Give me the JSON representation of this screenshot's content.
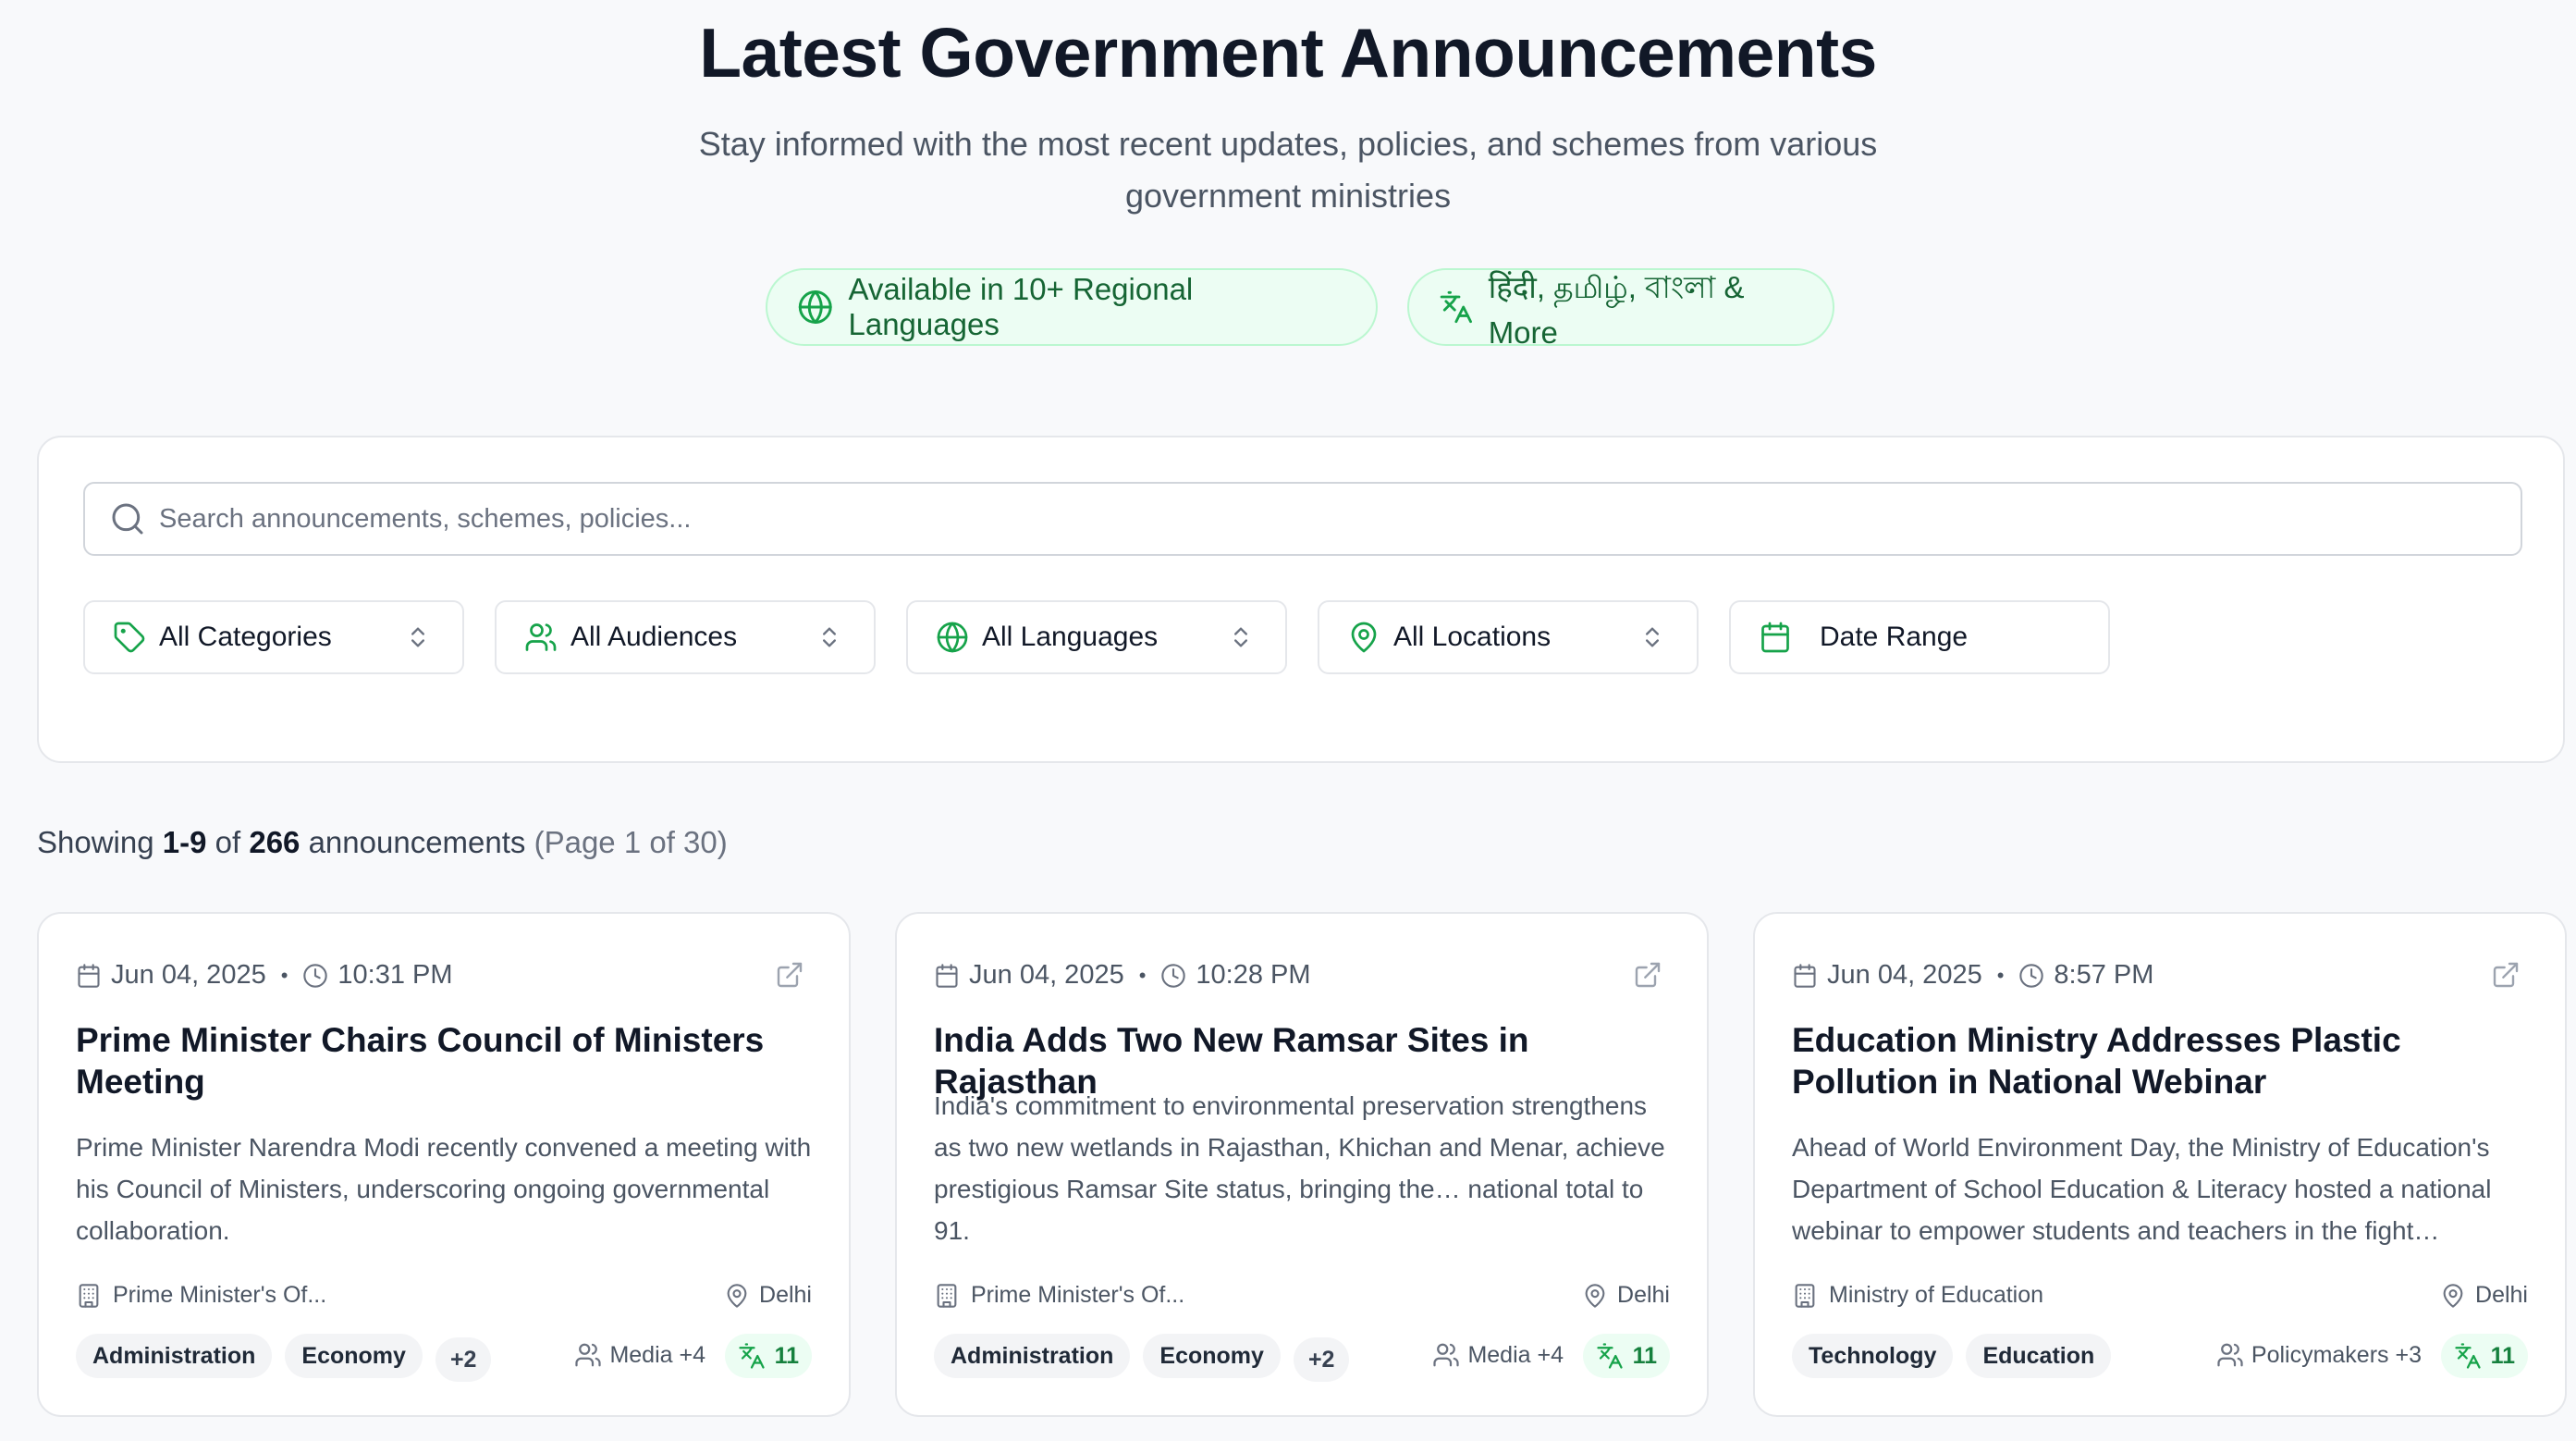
{
  "header": {
    "title": "Latest Government Announcements",
    "subtitle": "Stay informed with the most recent updates, policies, and schemes from various government ministries",
    "badges": [
      {
        "label": "Available in 10+ Regional Languages",
        "icon": "globe-icon"
      },
      {
        "label": "हिंदी, தமிழ், বাংলা & More",
        "icon": "translate-icon"
      }
    ]
  },
  "filters": {
    "search_placeholder": "Search announcements, schemes, policies...",
    "search_value": "",
    "selects": [
      {
        "label": "All Categories",
        "icon": "tag-icon"
      },
      {
        "label": "All Audiences",
        "icon": "users-icon"
      },
      {
        "label": "All Languages",
        "icon": "globe-icon"
      },
      {
        "label": "All Locations",
        "icon": "map-pin-icon"
      },
      {
        "label": "Date Range",
        "icon": "calendar-icon"
      }
    ]
  },
  "results": {
    "prefix": "Showing",
    "range": "1-9",
    "of": "of",
    "total": "266",
    "noun": "announcements",
    "page_info": "(Page 1 of 30)"
  },
  "cards": [
    {
      "date": "Jun 04, 2025",
      "time": "10:31 PM",
      "title": "Prime Minister Chairs Council of Ministers Meeting",
      "description": "Prime Minister Narendra Modi recently convened a meeting with his Council of Ministers, underscoring ongoing governmental collaboration.",
      "ministry": "Prime Minister's Of...",
      "location": "Delhi",
      "tags": [
        "Administration",
        "Economy"
      ],
      "more_tags": "+2",
      "audience": "Media +4",
      "languages": "11"
    },
    {
      "date": "Jun 04, 2025",
      "time": "10:28 PM",
      "title": "India Adds Two New Ramsar Sites in Rajasthan",
      "description": "India's commitment to environmental preservation strengthens as two new wetlands in Rajasthan, Khichan and Menar, achieve prestigious Ramsar Site status, bringing the… national total to 91.",
      "ministry": "Prime Minister's Of...",
      "location": "Delhi",
      "tags": [
        "Administration",
        "Economy"
      ],
      "more_tags": "+2",
      "audience": "Media +4",
      "languages": "11"
    },
    {
      "date": "Jun 04, 2025",
      "time": "8:57 PM",
      "title": "Education Ministry Addresses Plastic Pollution in National Webinar",
      "description": "Ahead of World Environment Day, the Ministry of Education's Department of School Education & Literacy hosted a national webinar to empower students and teachers in the fight…",
      "ministry": "Ministry of Education",
      "location": "Delhi",
      "tags": [
        "Technology",
        "Education"
      ],
      "more_tags": "",
      "audience": "Policymakers +3",
      "languages": "11"
    }
  ],
  "colors": {
    "accent": "#16a34a",
    "accent_bg": "#ecfdf3",
    "text_primary": "#111827",
    "text_muted": "#4b5563"
  }
}
